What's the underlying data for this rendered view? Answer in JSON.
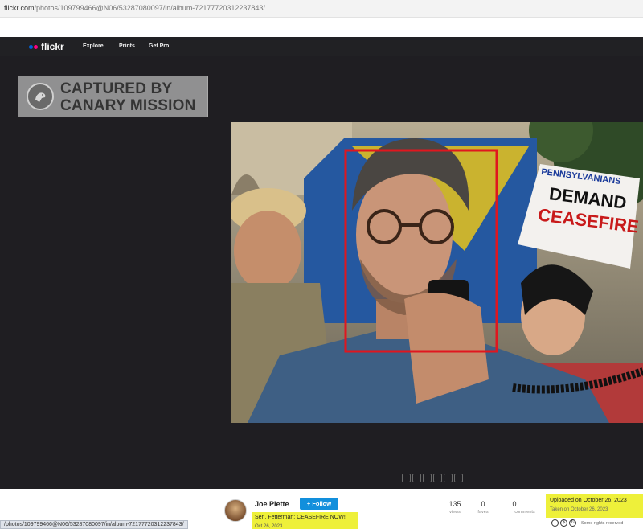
{
  "browser": {
    "url_host": "flickr.com",
    "url_path": "/photos/109799466@N06/53287080097/in/album-72177720312237843/"
  },
  "nav": {
    "logo_text": "flickr",
    "items": [
      "Explore",
      "Prints",
      "Get Pro"
    ]
  },
  "watermark": {
    "line1": "CAPTURED BY",
    "line2": "CANARY MISSION"
  },
  "photo": {
    "sign_lines": [
      "PENNSYLVANIANS",
      "DEMAND",
      "CEASEFIRE"
    ],
    "highlight_box_color": "#e0161e"
  },
  "info": {
    "author": "Joe Piette",
    "follow_label": "+ Follow",
    "title": "Sen. Fetterman: CEASEFIRE NOW!",
    "title_date": "Oct 26, 2023",
    "stats": [
      {
        "value": "135",
        "label": "views"
      },
      {
        "value": "0",
        "label": "faves"
      },
      {
        "value": "0",
        "label": "comments"
      }
    ],
    "uploaded": "Uploaded on October 26, 2023",
    "taken": "Taken on October 26, 2023",
    "rights": "Some rights reserved",
    "highlight_color": "#eef03a"
  },
  "status_bar": {
    "text": "/photos/109799466@N06/53287080097/in/album-72177720312237843/"
  }
}
